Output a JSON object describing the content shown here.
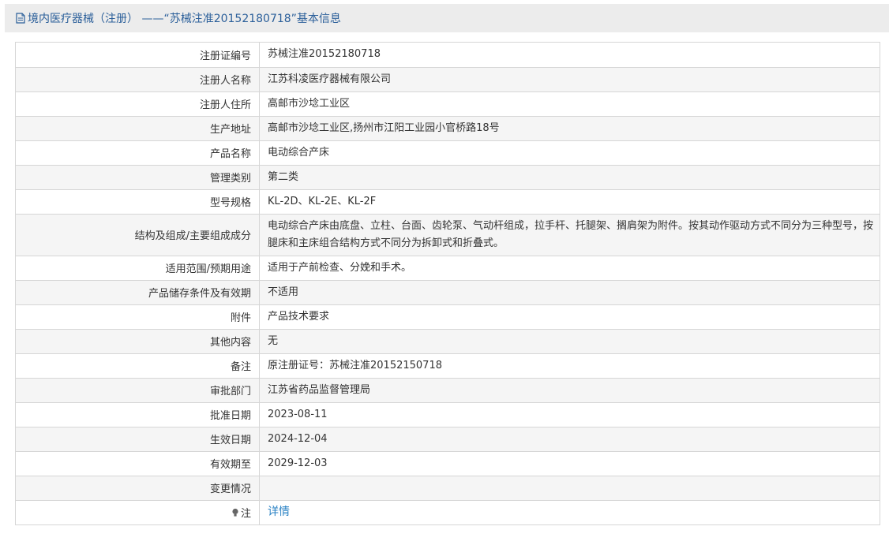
{
  "header": {
    "title": "境内医疗器械（注册） ——“苏械注准20152180718”基本信息",
    "icon": "document-icon"
  },
  "rows": [
    {
      "label": "注册证编号",
      "value": "苏械注准20152180718"
    },
    {
      "label": "注册人名称",
      "value": "江苏科凌医疗器械有限公司"
    },
    {
      "label": "注册人住所",
      "value": "高邮市沙埝工业区"
    },
    {
      "label": "生产地址",
      "value": "高邮市沙埝工业区,扬州市江阳工业园小官桥路18号"
    },
    {
      "label": "产品名称",
      "value": "电动综合产床"
    },
    {
      "label": "管理类别",
      "value": "第二类"
    },
    {
      "label": "型号规格",
      "value": "KL-2D、KL-2E、KL-2F"
    },
    {
      "label": "结构及组成/主要组成成分",
      "value": "电动综合产床由底盘、立柱、台面、齿轮泵、气动杆组成，拉手杆、托腿架、搁肩架为附件。按其动作驱动方式不同分为三种型号，按腿床和主床组合结构方式不同分为拆卸式和折叠式。"
    },
    {
      "label": "适用范围/预期用途",
      "value": "适用于产前检查、分娩和手术。"
    },
    {
      "label": "产品储存条件及有效期",
      "value": "不适用"
    },
    {
      "label": "附件",
      "value": "产品技术要求"
    },
    {
      "label": "其他内容",
      "value": "无"
    },
    {
      "label": "备注",
      "value": "原注册证号：苏械注准20152150718"
    },
    {
      "label": "审批部门",
      "value": "江苏省药品监督管理局"
    },
    {
      "label": "批准日期",
      "value": "2023-08-11"
    },
    {
      "label": "生效日期",
      "value": "2024-12-04"
    },
    {
      "label": "有效期至",
      "value": "2029-12-03"
    },
    {
      "label": "变更情况",
      "value": ""
    }
  ],
  "note": {
    "label": "注",
    "link": "详情",
    "icon": "lightbulb-icon"
  },
  "colors": {
    "link": "#2a82c4",
    "title": "#2b5f9a",
    "border": "#d6d6d6",
    "stripe": "#f5f5f5"
  }
}
